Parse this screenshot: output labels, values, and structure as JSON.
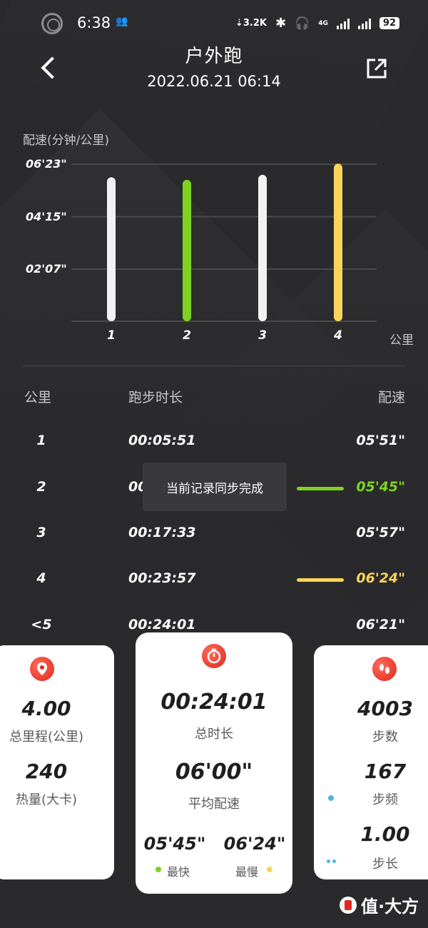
{
  "status_bar": {
    "time": "6:38",
    "net_speed": "3.2K",
    "network": "4G",
    "battery": "92"
  },
  "header": {
    "title": "户外跑",
    "datetime": "2022.06.21 06:14"
  },
  "chart_data": {
    "type": "bar",
    "title": "配速(分钟/公里)",
    "xlabel": "公里",
    "ylabel": "配速(分钟/公里)",
    "categories": [
      "1",
      "2",
      "3",
      "4"
    ],
    "values_seconds": [
      351,
      345,
      357,
      384
    ],
    "values_label": [
      "05'51\"",
      "05'45\"",
      "05'57\"",
      "06'24\""
    ],
    "y_ticks": [
      "06'23\"",
      "04'15\"",
      "02'07\""
    ],
    "y_tick_values": [
      383,
      255,
      127
    ],
    "ylim": [
      0,
      383
    ],
    "grid": true,
    "colors": [
      "#f2f2f2",
      "#7ed321",
      "#f2f2f2",
      "#f9d45c"
    ],
    "legend": "none"
  },
  "table": {
    "headers": {
      "km": "公里",
      "duration": "跑步时长",
      "pace": "配速"
    },
    "rows": [
      {
        "km": "1",
        "duration": "00:05:51",
        "pace": "05'51\""
      },
      {
        "km": "2",
        "duration": "00",
        "pace": "05'45\""
      },
      {
        "km": "3",
        "duration": "00:17:33",
        "pace": "05'57\""
      },
      {
        "km": "4",
        "duration": "00:23:57",
        "pace": "06'24\""
      },
      {
        "km": "<5",
        "duration": "00:24:01",
        "pace": "06'21\""
      }
    ]
  },
  "toast": {
    "text": "当前记录同步完成"
  },
  "cards": {
    "left": {
      "icon": "location-pin-icon",
      "distance_value": "4.00",
      "distance_label": "总里程(公里)",
      "calories_value": "240",
      "calories_label": "热量(大卡)"
    },
    "center": {
      "icon": "stopwatch-icon",
      "duration_value": "00:24:01",
      "duration_label": "总时长",
      "avg_pace_value": "06'00\"",
      "avg_pace_label": "平均配速",
      "fastest_value": "05'45\"",
      "fastest_label": "最快",
      "slowest_value": "06'24\"",
      "slowest_label": "最慢"
    },
    "right": {
      "icon": "footprints-icon",
      "steps_value": "4003",
      "steps_label": "步数",
      "cadence_value": "167",
      "cadence_label": "步频",
      "stride_value": "1.00",
      "stride_label": "步长"
    }
  },
  "watermark": {
    "text": "值·大方"
  },
  "colors": {
    "background": "#2a2a2c",
    "fastest": "#7ed321",
    "slowest": "#f9d45c",
    "accent": "#e0281c",
    "dot_blue": "#4fb3e6"
  }
}
